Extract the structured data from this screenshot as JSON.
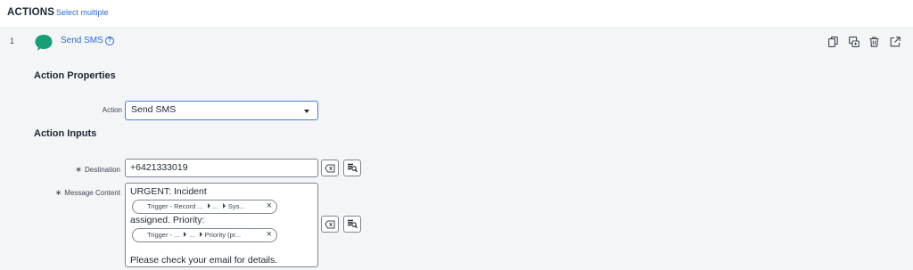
{
  "header": {
    "title": "ACTIONS",
    "select_multiple": "Select multiple"
  },
  "action_row": {
    "number": "1",
    "name": "Send SMS",
    "help_glyph": "?",
    "icon": "chat-bubble-icon",
    "tools": [
      "copy-icon",
      "duplicate-icon",
      "trash-icon",
      "open-external-icon"
    ]
  },
  "properties": {
    "section_title": "Action Properties",
    "action_label": "Action",
    "action_value": "Send SMS"
  },
  "inputs": {
    "section_title": "Action Inputs",
    "destination": {
      "required_mark": "∗",
      "label": "Destination",
      "value": "+6421333019"
    },
    "message": {
      "required_mark": "∗",
      "label": "Message Content",
      "line1": "URGENT: Incident",
      "pill1": {
        "part1": "Trigger - Record ...",
        "part2": "...",
        "part3": "Sys..."
      },
      "line2": "assigned. Priority:",
      "pill2": {
        "part1": "Trigger - ...",
        "part2": "...",
        "part3": "Priority (pr..."
      },
      "line3": "Please check your email for details."
    }
  },
  "colors": {
    "accent": "#2f6bd3",
    "sms_icon": "#1a9e78",
    "panel_bg": "#f4f5f7"
  }
}
